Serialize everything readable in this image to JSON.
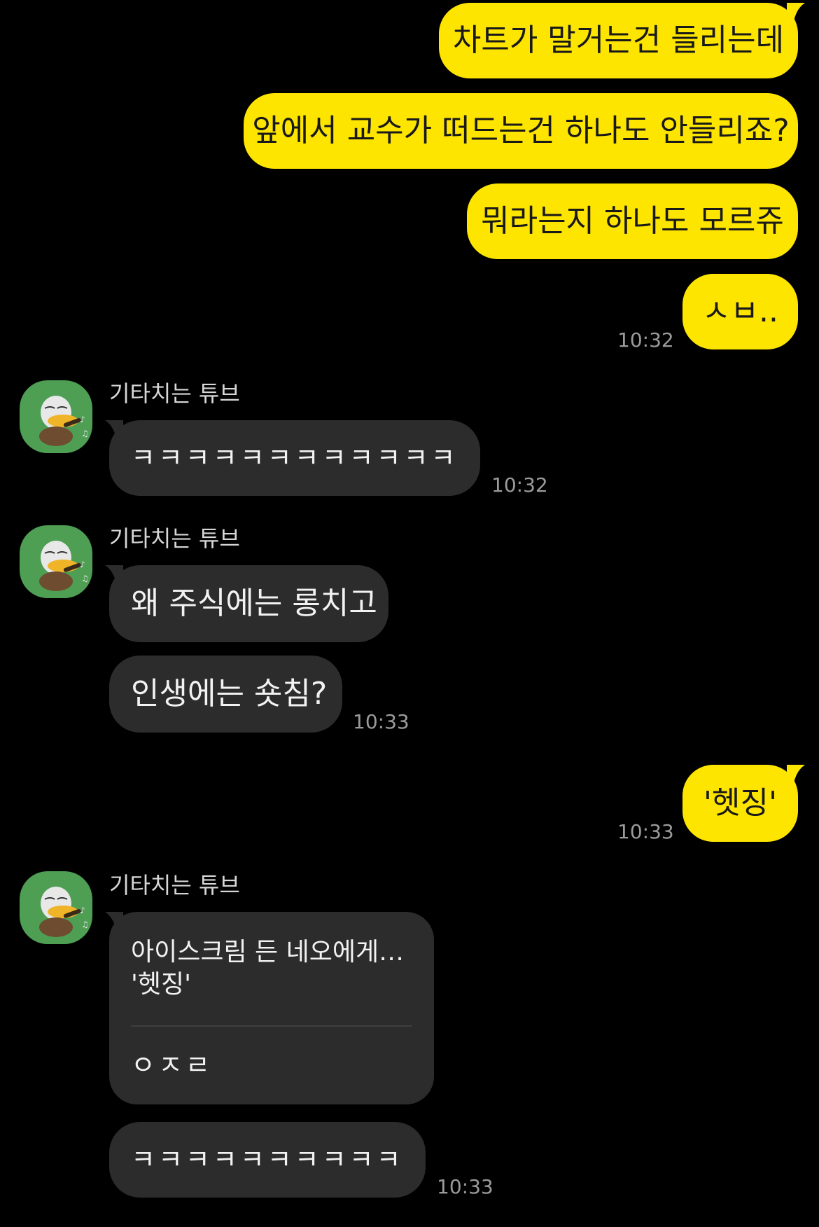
{
  "theme": {
    "background": "#000000",
    "outgoing_bubble": "#fee500",
    "outgoing_text": "#191919",
    "incoming_bubble": "#2c2c2c",
    "incoming_text": "#f2f2f2",
    "timestamp": "#9b9b9b",
    "avatar_bg": "#4e9e54"
  },
  "messages": {
    "out1": "차트가 말거는건 들리는데",
    "out2": "앞에서 교수가 떠드는건 하나도 안들리죠?",
    "out3": "뭐라는지 하나도 모르쥬",
    "out4": "ㅅㅂ..",
    "out4_time": "10:32",
    "group1_sender": "기타치는 튜브",
    "in1": "ㅋㅋㅋㅋㅋㅋㅋㅋㅋㅋㅋㅋ",
    "in1_time": "10:32",
    "group2_sender": "기타치는 튜브",
    "in2": "왜 주식에는 롱치고",
    "in3": "인생에는 숏침?",
    "in3_time": "10:33",
    "out5": "'헷징'",
    "out5_time": "10:33",
    "group3_sender": "기타치는 튜브",
    "quote_line1": "아이스크림 든 네오에게…",
    "quote_line2": "'헷징'",
    "reply": "ㅇㅈㄹ",
    "in4": "ㅋㅋㅋㅋㅋㅋㅋㅋㅋㅋ",
    "in4_time": "10:33"
  },
  "icons": {
    "avatar": "tube-duck-guitar-avatar"
  }
}
